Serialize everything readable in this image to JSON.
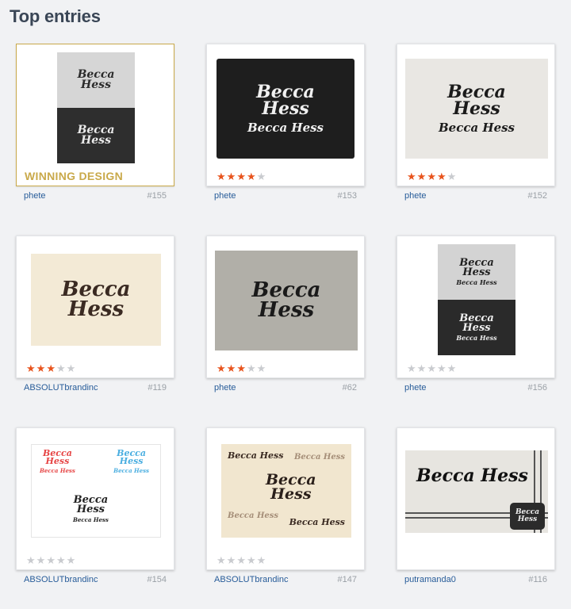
{
  "page_title": "Top entries",
  "winning_label": "WINNING DESIGN",
  "logo_text": {
    "line1": "Becca",
    "line2": "Hess",
    "inline": "Becca Hess"
  },
  "colors": {
    "star_on": "#e8541d",
    "star_off": "#c9cbcf",
    "winner": "#c9a94a",
    "author_link": "#275c99"
  },
  "entries": [
    {
      "author": "phete",
      "number": "#155",
      "rating": 0,
      "winner": true
    },
    {
      "author": "phete",
      "number": "#153",
      "rating": 4,
      "winner": false
    },
    {
      "author": "phete",
      "number": "#152",
      "rating": 4,
      "winner": false
    },
    {
      "author": "ABSOLUTbrandinc",
      "number": "#119",
      "rating": 3,
      "winner": false
    },
    {
      "author": "phete",
      "number": "#62",
      "rating": 3,
      "winner": false
    },
    {
      "author": "phete",
      "number": "#156",
      "rating": 0,
      "winner": false
    },
    {
      "author": "ABSOLUTbrandinc",
      "number": "#154",
      "rating": 0,
      "winner": false
    },
    {
      "author": "ABSOLUTbrandinc",
      "number": "#147",
      "rating": 0,
      "winner": false
    },
    {
      "author": "putramanda0",
      "number": "#116",
      "rating": 0,
      "winner": false
    }
  ]
}
